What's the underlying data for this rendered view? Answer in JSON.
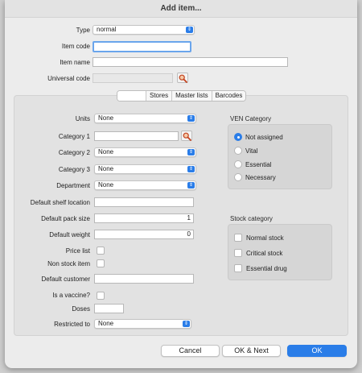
{
  "window": {
    "title": "Add item..."
  },
  "header": {
    "type_label": "Type",
    "type_value": "normal",
    "item_code_label": "Item code",
    "item_code_value": "",
    "item_name_label": "Item name",
    "item_name_value": "",
    "universal_code_label": "Universal code",
    "universal_code_value": ""
  },
  "tabs": [
    {
      "label": ""
    },
    {
      "label": "Stores"
    },
    {
      "label": "Master lists"
    },
    {
      "label": "Barcodes"
    }
  ],
  "form": {
    "units_label": "Units",
    "units_value": "None",
    "category1_label": "Category 1",
    "category1_value": "",
    "category2_label": "Category 2",
    "category2_value": "None",
    "category3_label": "Category 3",
    "category3_value": "None",
    "department_label": "Department",
    "department_value": "None",
    "shelf_label": "Default shelf location",
    "shelf_value": "",
    "pack_label": "Default pack size",
    "pack_value": "1",
    "weight_label": "Default weight",
    "weight_value": "0",
    "price_list_label": "Price list",
    "price_list_checked": false,
    "non_stock_label": "Non stock item",
    "non_stock_checked": false,
    "customer_label": "Default customer",
    "customer_value": "",
    "vaccine_label": "Is a vaccine?",
    "vaccine_checked": false,
    "doses_label": "Doses",
    "doses_value": "",
    "restricted_label": "Restricted to",
    "restricted_value": "None"
  },
  "ven": {
    "title": "VEN Category",
    "options": [
      {
        "label": "Not assigned",
        "selected": true
      },
      {
        "label": "Vital",
        "selected": false
      },
      {
        "label": "Essential",
        "selected": false
      },
      {
        "label": "Necessary",
        "selected": false
      }
    ]
  },
  "stock": {
    "title": "Stock category",
    "options": [
      {
        "label": "Normal stock",
        "checked": false
      },
      {
        "label": "Critical stock",
        "checked": false
      },
      {
        "label": "Essential drug",
        "checked": false
      }
    ]
  },
  "buttons": {
    "cancel": "Cancel",
    "ok_next": "OK & Next",
    "ok": "OK"
  },
  "colors": {
    "accent": "#2a7de8",
    "focus_ring": "#6aa5ec"
  },
  "icons": {
    "lookup": "magnifier-icon",
    "popup": "up-down-arrows-icon"
  }
}
